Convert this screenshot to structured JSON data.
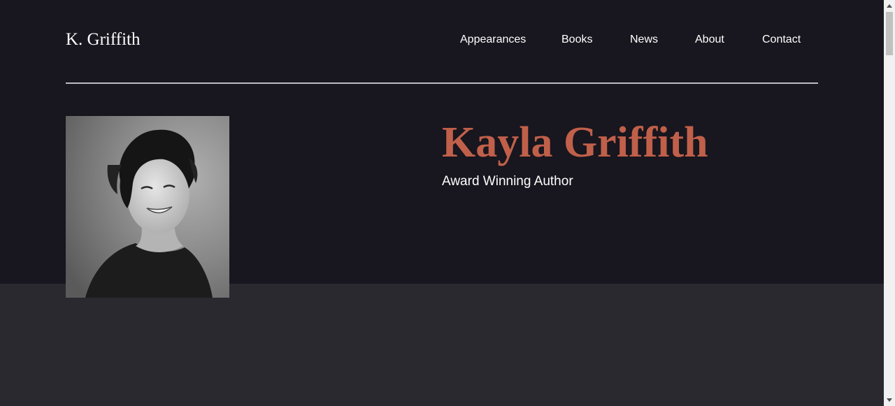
{
  "site": {
    "logo": "K. Griffith"
  },
  "nav": {
    "items": [
      {
        "label": "Appearances"
      },
      {
        "label": "Books"
      },
      {
        "label": "News"
      },
      {
        "label": "About"
      },
      {
        "label": "Contact"
      }
    ]
  },
  "hero": {
    "name": "Kayla Griffith",
    "tagline": "Award Winning Author",
    "portrait_icon": "author-portrait-photo"
  },
  "colors": {
    "hero_background": "#18161e",
    "lower_background": "#2a292f",
    "accent": "#c0604a",
    "text": "#ffffff",
    "divider": "#bdbcc2"
  },
  "scrollbar": {
    "up_icon": "arrow-up-icon",
    "down_icon": "arrow-down-icon"
  }
}
